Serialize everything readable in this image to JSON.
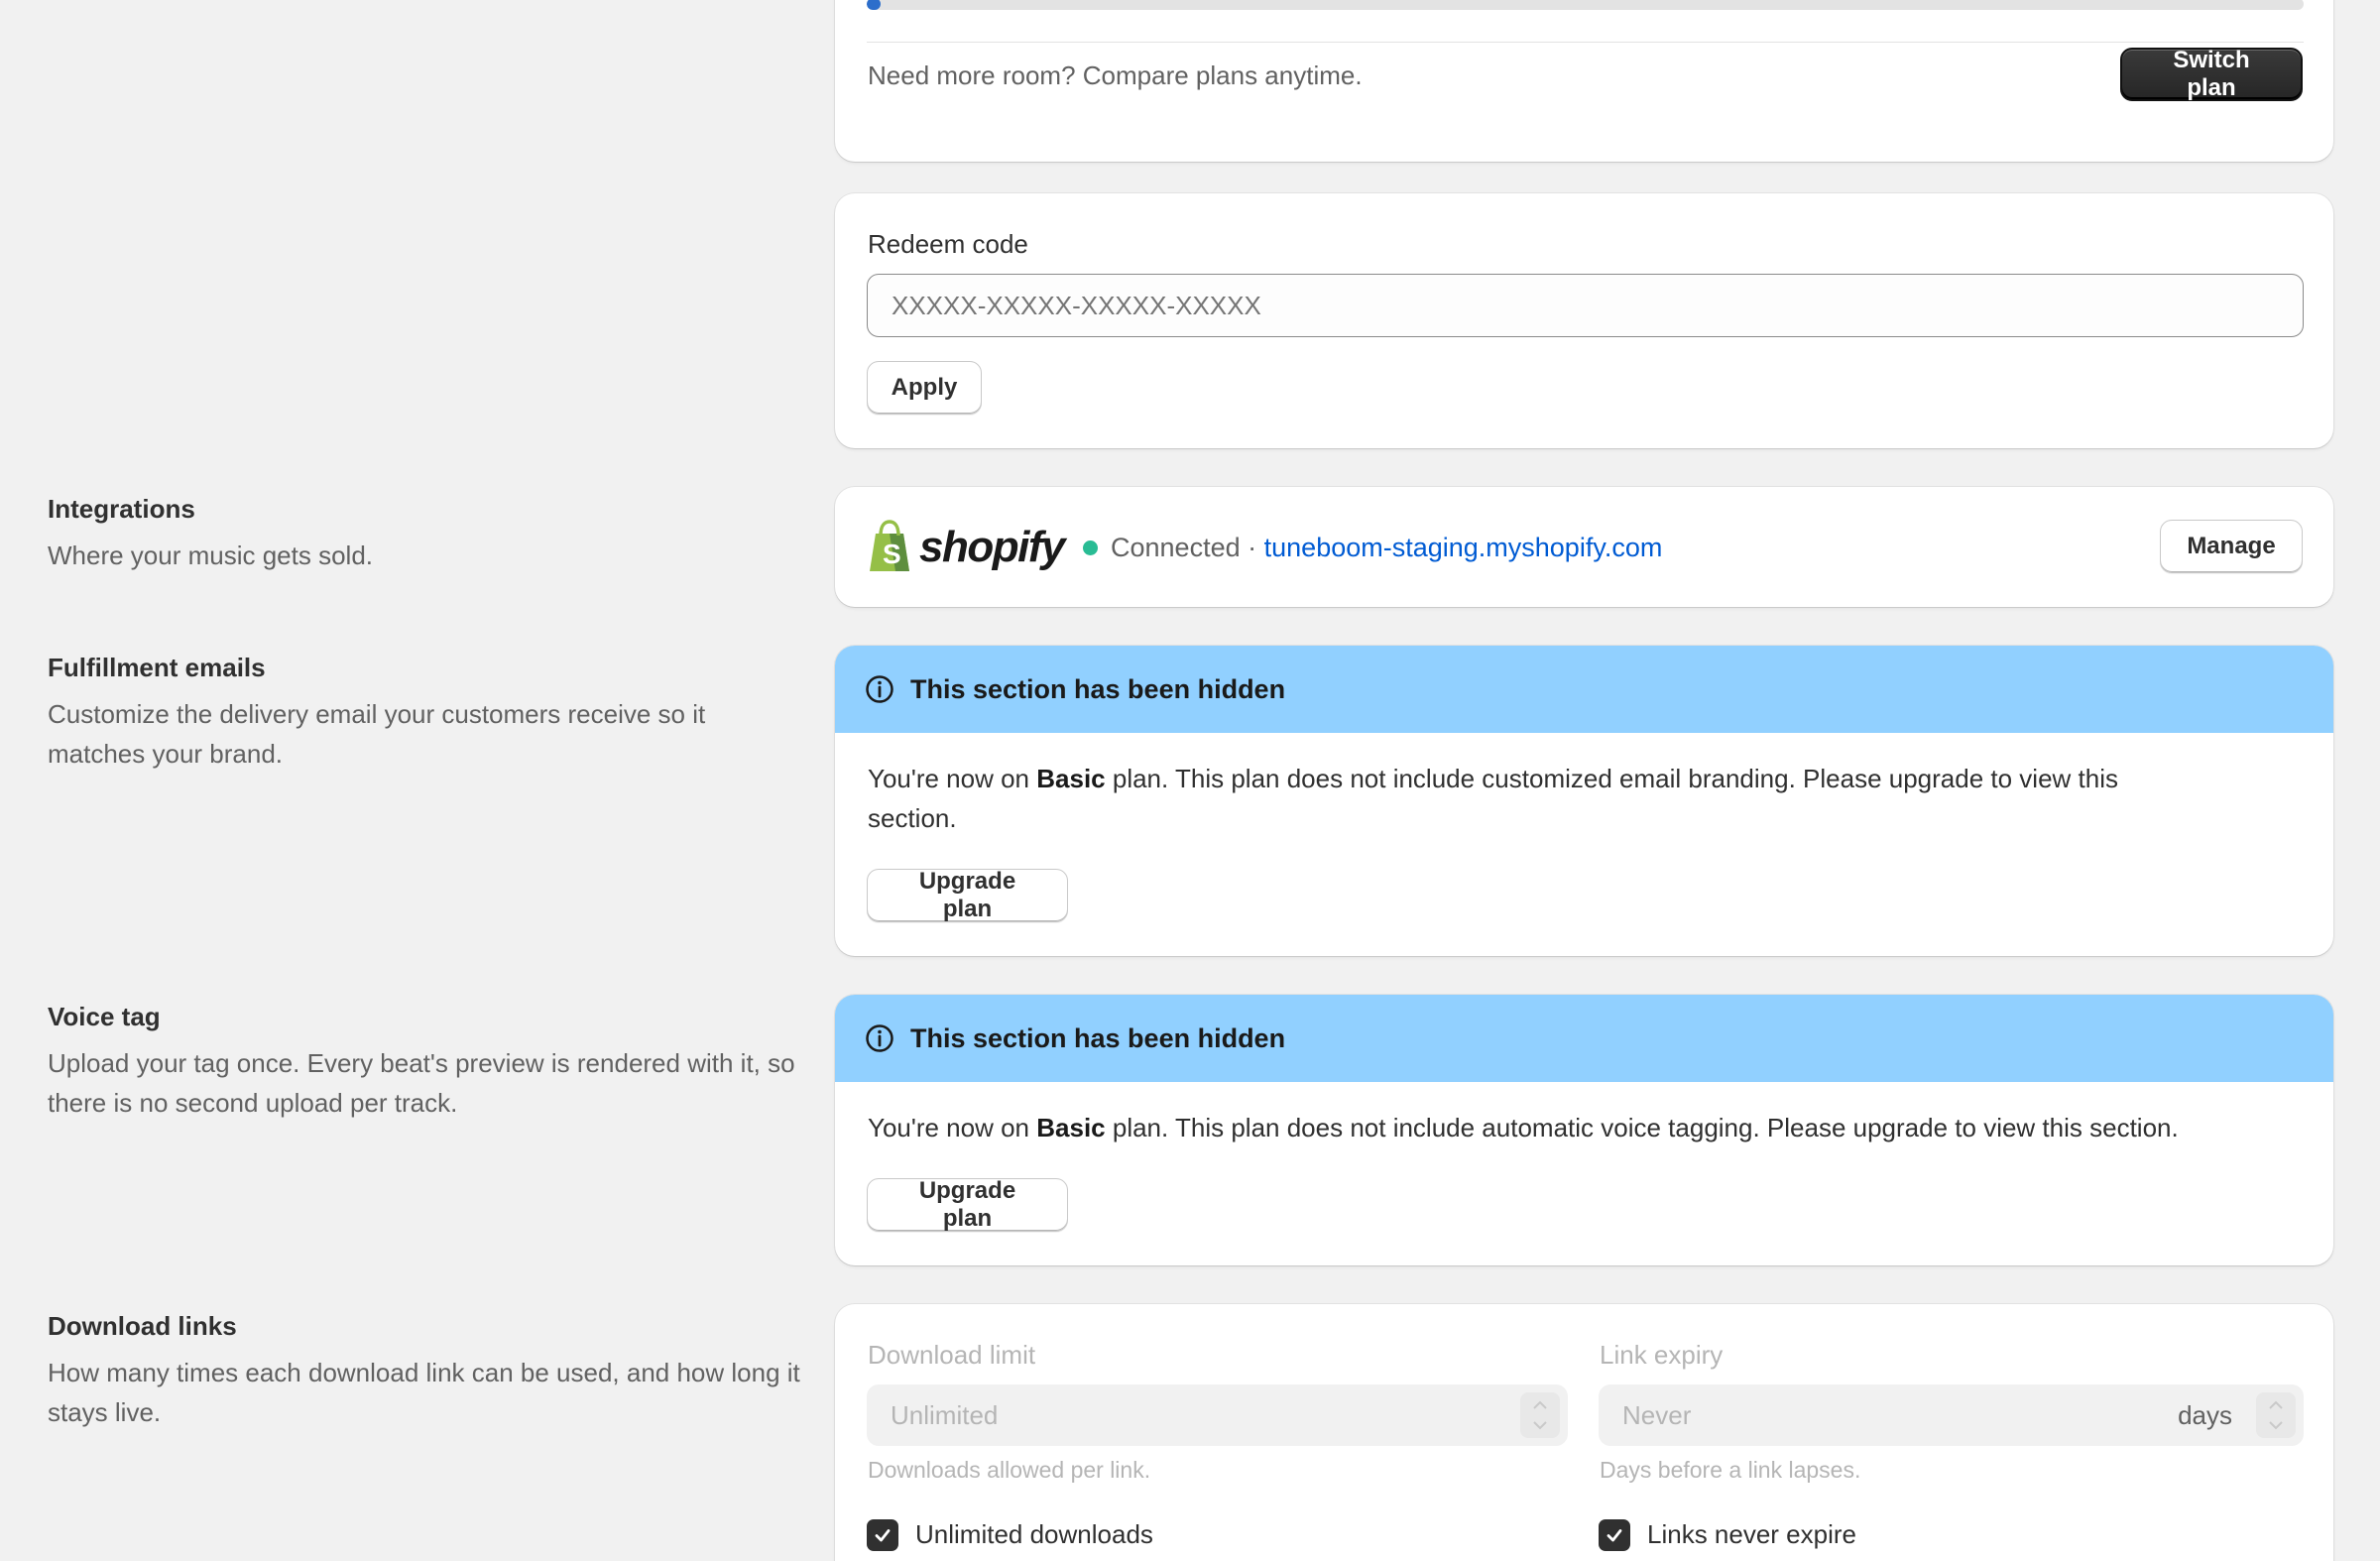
{
  "plan_card": {
    "usage_percent": 1,
    "compare_text": "Need more room? Compare plans anytime.",
    "switch_label": "Switch plan"
  },
  "redeem": {
    "label": "Redeem code",
    "placeholder": "XXXXX-XXXXX-XXXXX-XXXXX",
    "apply_label": "Apply"
  },
  "integrations": {
    "title": "Integrations",
    "description": "Where your music gets sold.",
    "provider_logo": "shopify",
    "status": "Connected",
    "separator": "·",
    "store_url": "tuneboom-staging.myshopify.com",
    "manage_label": "Manage",
    "status_color": "#29bc94",
    "link_color": "#005bd3",
    "logo_green": "#95bf47"
  },
  "fulfillment": {
    "title": "Fulfillment emails",
    "description": "Customize the delivery email your customers receive so it matches your brand.",
    "banner_title": "This section has been hidden",
    "body_prefix": "You're now on ",
    "plan_name": "Basic",
    "body_suffix": " plan. This plan does not include customized email branding. Please upgrade to view this section.",
    "upgrade_label": "Upgrade plan"
  },
  "voice_tag": {
    "title": "Voice tag",
    "description": "Upload your tag once. Every beat's preview is rendered with it, so there is no second upload per track.",
    "banner_title": "This section has been hidden",
    "body_prefix": "You're now on ",
    "plan_name": "Basic",
    "body_suffix": " plan. This plan does not include automatic voice tagging. Please upgrade to view this section.",
    "upgrade_label": "Upgrade plan"
  },
  "download_links": {
    "title": "Download links",
    "description": "How many times each download link can be used, and how long it stays live.",
    "limit_label": "Download limit",
    "limit_value": "Unlimited",
    "limit_help": "Downloads allowed per link.",
    "expiry_label": "Link expiry",
    "expiry_value": "Never",
    "expiry_suffix": "days",
    "expiry_help": "Days before a link lapses.",
    "unlimited_checkbox": "Unlimited downloads",
    "never_expire_checkbox": "Links never expire"
  },
  "colors": {
    "banner_bg": "#91d0ff",
    "progress_fill": "#2c6ecb"
  }
}
